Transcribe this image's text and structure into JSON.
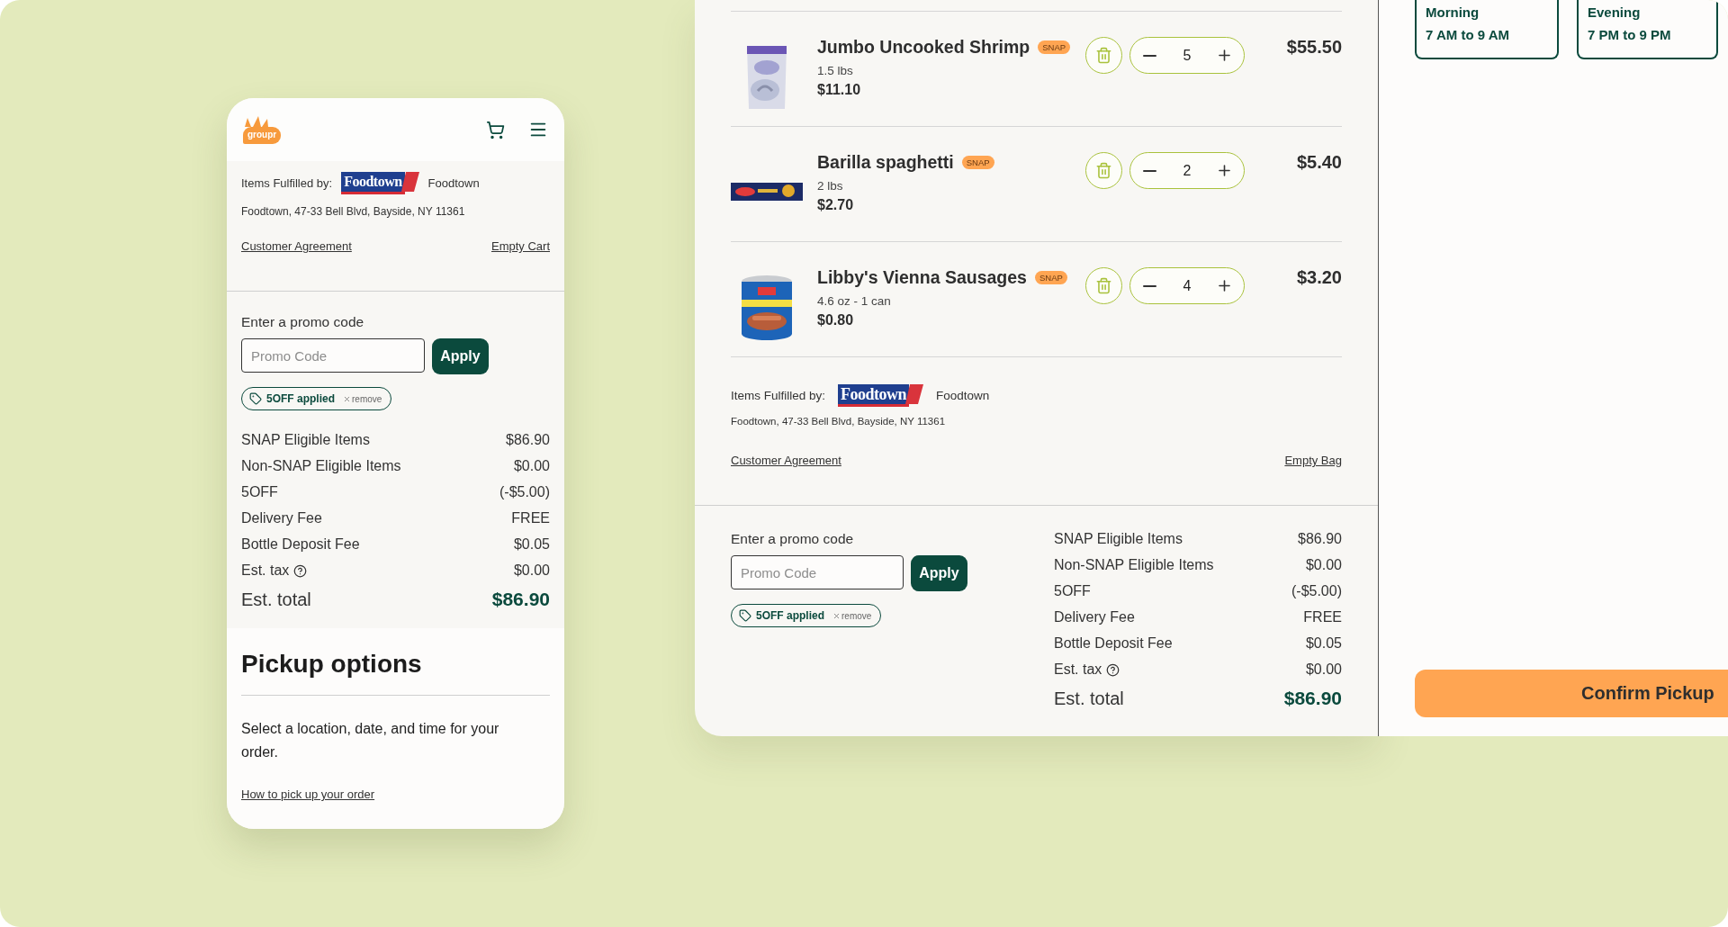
{
  "mobile": {
    "logo_text": "groupr",
    "fulfillment": {
      "label": "Items Fulfilled by:",
      "store_logo": "Foodtown",
      "store_name": "Foodtown",
      "address": "Foodtown, 47-33 Bell Blvd, Bayside, NY 11361",
      "left_link": "Customer Agreement",
      "right_link": "Empty Cart"
    },
    "promo": {
      "label": "Enter a promo code",
      "placeholder": "Promo Code",
      "button": "Apply",
      "applied": "5OFF applied",
      "remove": "remove"
    },
    "summary": [
      {
        "kind": "line",
        "label": "SNAP Eligible Items",
        "value": "$86.90"
      },
      {
        "kind": "line",
        "label": "Non-SNAP Eligible Items",
        "value": "$0.00"
      },
      {
        "kind": "line",
        "label": "5OFF",
        "value": "(-$5.00)"
      },
      {
        "kind": "line",
        "label": "Delivery Fee",
        "value": "FREE"
      },
      {
        "kind": "line",
        "label": "Bottle Deposit Fee",
        "value": "$0.05"
      },
      {
        "kind": "help",
        "label": "Est. tax",
        "value": "$0.00"
      },
      {
        "kind": "total",
        "label": "Est. total",
        "value": "$86.90"
      }
    ],
    "pickup": {
      "title": "Pickup options",
      "text": "Select a location, date, and time for your order.",
      "link": "How to pick up your order"
    }
  },
  "cart": {
    "items": [
      {
        "name": "Jumbo Uncooked Shrimp",
        "badge": "SNAP",
        "size": "1.5 lbs",
        "unit_price": "$11.10",
        "quantity": "5",
        "price": "$55.50",
        "kind": "bag"
      },
      {
        "name": "Barilla spaghetti",
        "badge": "SNAP",
        "size": "2 lbs",
        "unit_price": "$2.70",
        "quantity": "2",
        "price": "$5.40",
        "kind": "box"
      },
      {
        "name": "Libby's Vienna Sausages",
        "badge": "SNAP",
        "size": "4.6 oz - 1 can",
        "unit_price": "$0.80",
        "quantity": "4",
        "price": "$3.20",
        "kind": "can"
      }
    ],
    "fulfillment": {
      "label": "Items Fulfilled by:",
      "store_logo": "Foodtown",
      "store_name": "Foodtown",
      "address": "Foodtown, 47-33 Bell Blvd, Bayside, NY 11361",
      "left_link": "Customer Agreement",
      "right_link": "Empty Bag"
    },
    "promo": {
      "label": "Enter a promo code",
      "placeholder": "Promo Code",
      "button": "Apply",
      "applied": "5OFF applied",
      "remove": "remove"
    },
    "summary": [
      {
        "kind": "line",
        "label": "SNAP Eligible Items",
        "value": "$86.90"
      },
      {
        "kind": "line",
        "label": "Non-SNAP Eligible Items",
        "value": "$0.00"
      },
      {
        "kind": "line",
        "label": "5OFF",
        "value": "(-$5.00)"
      },
      {
        "kind": "line",
        "label": "Delivery Fee",
        "value": "FREE"
      },
      {
        "kind": "line",
        "label": "Bottle Deposit Fee",
        "value": "$0.05"
      },
      {
        "kind": "help",
        "label": "Est. tax",
        "value": "$0.00"
      },
      {
        "kind": "total",
        "label": "Est. total",
        "value": "$86.90"
      }
    ]
  },
  "pickup_panel": {
    "time_slots": [
      {
        "label": "Morning",
        "time": "7 AM to 9 AM"
      },
      {
        "label": "Evening",
        "time": "7 PM to 9 PM"
      }
    ],
    "confirm_button": "Confirm Pickup"
  }
}
